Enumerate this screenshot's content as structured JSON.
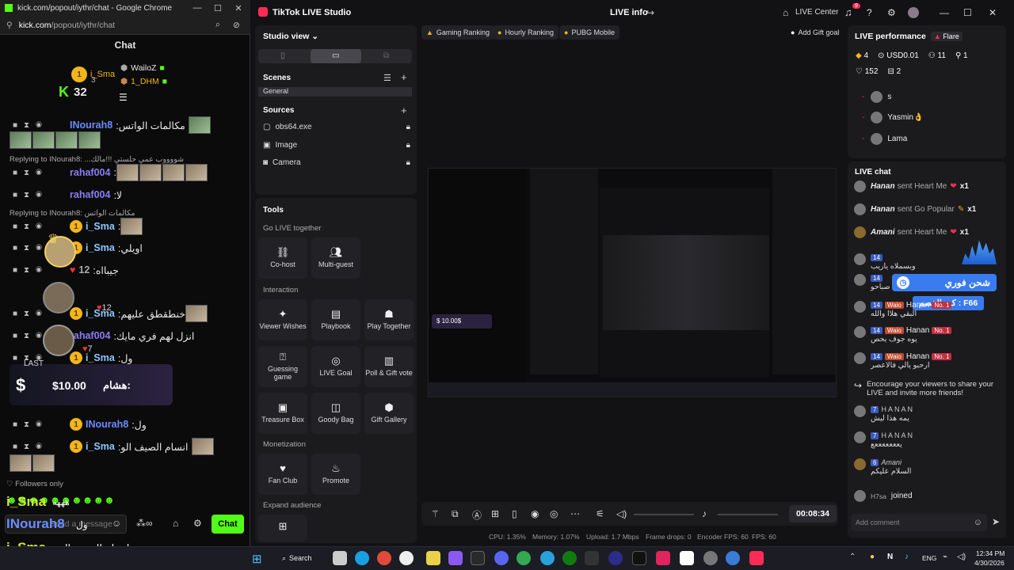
{
  "kick": {
    "window_title": "kick.com/popout/iythr/chat - Google Chrome",
    "url_host": "kick.com",
    "url_path": "/popout/iythr/chat",
    "chat_title": "Chat",
    "leaderboard": [
      {
        "rank": "1",
        "name": "i_Sma",
        "name2": "WailoZ"
      },
      {
        "rank": "3",
        "name": "1_DHM"
      }
    ],
    "kick_count": "32",
    "messages": [
      {
        "name": "INourah8",
        "text": ":مكالمات الواتس",
        "color": "#6c8cff"
      },
      {
        "reply": "Replying to INourah8: ...شووووب عمي حلستي !!!مالك"
      },
      {
        "name": "rahaf004",
        "text": ":",
        "color": "#8b7cf6"
      },
      {
        "name": "rahaf004",
        "text": ":لا",
        "color": "#8b7cf6"
      },
      {
        "reply": "Replying to INourah8: مكالمات الواتس"
      },
      {
        "name": "i_Sma",
        "text": ":",
        "color": "#8ec6ff"
      },
      {
        "name": "i_Sma",
        "text": ":اويلي",
        "color": "#8ec6ff"
      },
      {
        "name": "12",
        "text": ":جيبااه",
        "color": "#aaa"
      },
      {
        "name": "i_Sma",
        "text": ":خنطقطق عليهم",
        "color": "#8ec6ff"
      },
      {
        "name": "rahaf004",
        "text": ":انزل لهم فري مايك",
        "color": "#8b7cf6"
      },
      {
        "name": "i_Sma",
        "text": ":ول",
        "color": "#8ec6ff"
      },
      {
        "name": "INourah8",
        "text": ":ول",
        "color": "#6c8cff"
      },
      {
        "name": "i_Sma",
        "text": ":انسام الصيف الو",
        "color": "#8ec6ff"
      }
    ],
    "tip": {
      "label": "LAST",
      "name": "هشام:",
      "amount": "$10.00",
      "count": "12",
      "count2": "7"
    },
    "followers_only": "Followers only",
    "footer_lines": [
      {
        "name": "i_Sma",
        "text": "هههه"
      },
      {
        "name": "INourah8",
        "text": "ول"
      },
      {
        "name": "i_Sma",
        "text": "انسام الصيف الو"
      }
    ],
    "send_placeholder": "Send a message",
    "chat_button": "Chat"
  },
  "studio": {
    "app_title": "TikTok LIVE Studio",
    "live_info": "LIVE info",
    "live_center": "LIVE Center",
    "notif_count": "9",
    "studio_view": "Studio view",
    "scenes": "Scenes",
    "scene_general": "General",
    "sources": "Sources",
    "source_items": [
      "obs64.exe",
      "Image",
      "Camera"
    ],
    "tools": "Tools",
    "go_live_together": "Go LIVE together",
    "interaction": "Interaction",
    "monetization": "Monetization",
    "expand_audience": "Expand audience",
    "tool_cohost": "Co-host",
    "tool_multiguest": "Multi-guest",
    "tool_viewer_wishes": "Viewer Wishes",
    "tool_playbook": "Playbook",
    "tool_play_together": "Play Together",
    "tool_guessing": "Guessing game",
    "tool_live_goal": "LIVE Goal",
    "tool_poll": "Poll & Gift vote",
    "tool_treasure": "Treasure Box",
    "tool_goody": "Goody Bag",
    "tool_gift_gallery": "Gift Gallery",
    "tool_fan_club": "Fan Club",
    "tool_promote": "Promote",
    "chips": [
      "Gaming Ranking",
      "Hourly Ranking",
      "PUBG Mobile"
    ],
    "add_gift_goal": "Add Gift goal",
    "timer": "00:08:34",
    "stats": {
      "cpu": "CPU: 1.35%",
      "memory": "Memory: 1.07%",
      "upload": "Upload: 1.7 Mbps",
      "frame_drops": "Frame drops: 0",
      "encoder_fps": "Encoder FPS: 60",
      "fps": "FPS: 60"
    }
  },
  "perf": {
    "title": "LIVE performance",
    "tag": "Flare",
    "diamonds": "4",
    "usd": "USD0.01",
    "viewers": "11",
    "new_followers": "1",
    "likes": "152",
    "gifts": "2",
    "ranking": [
      "s",
      "Yasmin👌",
      "Lama"
    ]
  },
  "livechat": {
    "title": "LIVE chat",
    "gifts": [
      {
        "name": "Hanan",
        "text": "sent Heart Me",
        "count": "x1"
      },
      {
        "name": "Hanan",
        "text": "sent Go Popular",
        "count": "x1"
      },
      {
        "name": "Amani",
        "text": "sent Heart Me",
        "count": "x1"
      }
    ],
    "overlay_top": "شحن فوري",
    "overlay_code": "كود الخصم : F66",
    "comments": [
      {
        "lvl": "14",
        "text": "وبسملاه ياريب"
      },
      {
        "lvl": "14",
        "text": "صباحو"
      },
      {
        "lvl": "14",
        "badge": "Waio",
        "name": "Hanan",
        "no": "No. 1",
        "text": "البقي هلاا والله"
      },
      {
        "lvl": "14",
        "badge": "Waio",
        "name": "Hanan",
        "no": "No. 1",
        "text": "يوه جوف بحص"
      },
      {
        "lvl": "14",
        "badge": "Waio",
        "name": "Hanan",
        "no": "No. 1",
        "text": "ارحبو يالي فالاعصر"
      }
    ],
    "share_prompt": "Encourage your viewers to share your LIVE and invite more friends!",
    "later": [
      {
        "lvl": "7",
        "name": "HANAN",
        "text": "يمه هذا ليش"
      },
      {
        "lvl": "7",
        "name": "HANAN",
        "text": "يعععععععع"
      },
      {
        "lvl": "6",
        "name": "Amani",
        "text": "السلام عليكم"
      }
    ],
    "joined_name": "H7sa",
    "joined": "joined",
    "add_comment": "Add comment"
  },
  "taskbar": {
    "search": "Search",
    "lang": "ENG",
    "time": "12:34 PM",
    "date": "4/30/2026"
  }
}
